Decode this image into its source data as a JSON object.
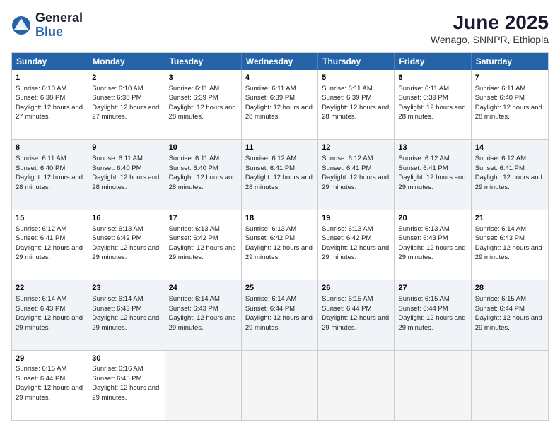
{
  "logo": {
    "line1": "General",
    "line2": "Blue"
  },
  "header": {
    "month": "June 2025",
    "location": "Wenago, SNNPR, Ethiopia"
  },
  "days": [
    "Sunday",
    "Monday",
    "Tuesday",
    "Wednesday",
    "Thursday",
    "Friday",
    "Saturday"
  ],
  "rows": [
    [
      {
        "day": "1",
        "sunrise": "6:10 AM",
        "sunset": "6:38 PM",
        "daylight": "12 hours and 27 minutes."
      },
      {
        "day": "2",
        "sunrise": "6:10 AM",
        "sunset": "6:38 PM",
        "daylight": "12 hours and 27 minutes."
      },
      {
        "day": "3",
        "sunrise": "6:11 AM",
        "sunset": "6:39 PM",
        "daylight": "12 hours and 28 minutes."
      },
      {
        "day": "4",
        "sunrise": "6:11 AM",
        "sunset": "6:39 PM",
        "daylight": "12 hours and 28 minutes."
      },
      {
        "day": "5",
        "sunrise": "6:11 AM",
        "sunset": "6:39 PM",
        "daylight": "12 hours and 28 minutes."
      },
      {
        "day": "6",
        "sunrise": "6:11 AM",
        "sunset": "6:39 PM",
        "daylight": "12 hours and 28 minutes."
      },
      {
        "day": "7",
        "sunrise": "6:11 AM",
        "sunset": "6:40 PM",
        "daylight": "12 hours and 28 minutes."
      }
    ],
    [
      {
        "day": "8",
        "sunrise": "6:11 AM",
        "sunset": "6:40 PM",
        "daylight": "12 hours and 28 minutes."
      },
      {
        "day": "9",
        "sunrise": "6:11 AM",
        "sunset": "6:40 PM",
        "daylight": "12 hours and 28 minutes."
      },
      {
        "day": "10",
        "sunrise": "6:11 AM",
        "sunset": "6:40 PM",
        "daylight": "12 hours and 28 minutes."
      },
      {
        "day": "11",
        "sunrise": "6:12 AM",
        "sunset": "6:41 PM",
        "daylight": "12 hours and 28 minutes."
      },
      {
        "day": "12",
        "sunrise": "6:12 AM",
        "sunset": "6:41 PM",
        "daylight": "12 hours and 29 minutes."
      },
      {
        "day": "13",
        "sunrise": "6:12 AM",
        "sunset": "6:41 PM",
        "daylight": "12 hours and 29 minutes."
      },
      {
        "day": "14",
        "sunrise": "6:12 AM",
        "sunset": "6:41 PM",
        "daylight": "12 hours and 29 minutes."
      }
    ],
    [
      {
        "day": "15",
        "sunrise": "6:12 AM",
        "sunset": "6:41 PM",
        "daylight": "12 hours and 29 minutes."
      },
      {
        "day": "16",
        "sunrise": "6:13 AM",
        "sunset": "6:42 PM",
        "daylight": "12 hours and 29 minutes."
      },
      {
        "day": "17",
        "sunrise": "6:13 AM",
        "sunset": "6:42 PM",
        "daylight": "12 hours and 29 minutes."
      },
      {
        "day": "18",
        "sunrise": "6:13 AM",
        "sunset": "6:42 PM",
        "daylight": "12 hours and 29 minutes."
      },
      {
        "day": "19",
        "sunrise": "6:13 AM",
        "sunset": "6:42 PM",
        "daylight": "12 hours and 29 minutes."
      },
      {
        "day": "20",
        "sunrise": "6:13 AM",
        "sunset": "6:43 PM",
        "daylight": "12 hours and 29 minutes."
      },
      {
        "day": "21",
        "sunrise": "6:14 AM",
        "sunset": "6:43 PM",
        "daylight": "12 hours and 29 minutes."
      }
    ],
    [
      {
        "day": "22",
        "sunrise": "6:14 AM",
        "sunset": "6:43 PM",
        "daylight": "12 hours and 29 minutes."
      },
      {
        "day": "23",
        "sunrise": "6:14 AM",
        "sunset": "6:43 PM",
        "daylight": "12 hours and 29 minutes."
      },
      {
        "day": "24",
        "sunrise": "6:14 AM",
        "sunset": "6:43 PM",
        "daylight": "12 hours and 29 minutes."
      },
      {
        "day": "25",
        "sunrise": "6:14 AM",
        "sunset": "6:44 PM",
        "daylight": "12 hours and 29 minutes."
      },
      {
        "day": "26",
        "sunrise": "6:15 AM",
        "sunset": "6:44 PM",
        "daylight": "12 hours and 29 minutes."
      },
      {
        "day": "27",
        "sunrise": "6:15 AM",
        "sunset": "6:44 PM",
        "daylight": "12 hours and 29 minutes."
      },
      {
        "day": "28",
        "sunrise": "6:15 AM",
        "sunset": "6:44 PM",
        "daylight": "12 hours and 29 minutes."
      }
    ],
    [
      {
        "day": "29",
        "sunrise": "6:15 AM",
        "sunset": "6:44 PM",
        "daylight": "12 hours and 29 minutes."
      },
      {
        "day": "30",
        "sunrise": "6:16 AM",
        "sunset": "6:45 PM",
        "daylight": "12 hours and 29 minutes."
      },
      null,
      null,
      null,
      null,
      null
    ]
  ]
}
